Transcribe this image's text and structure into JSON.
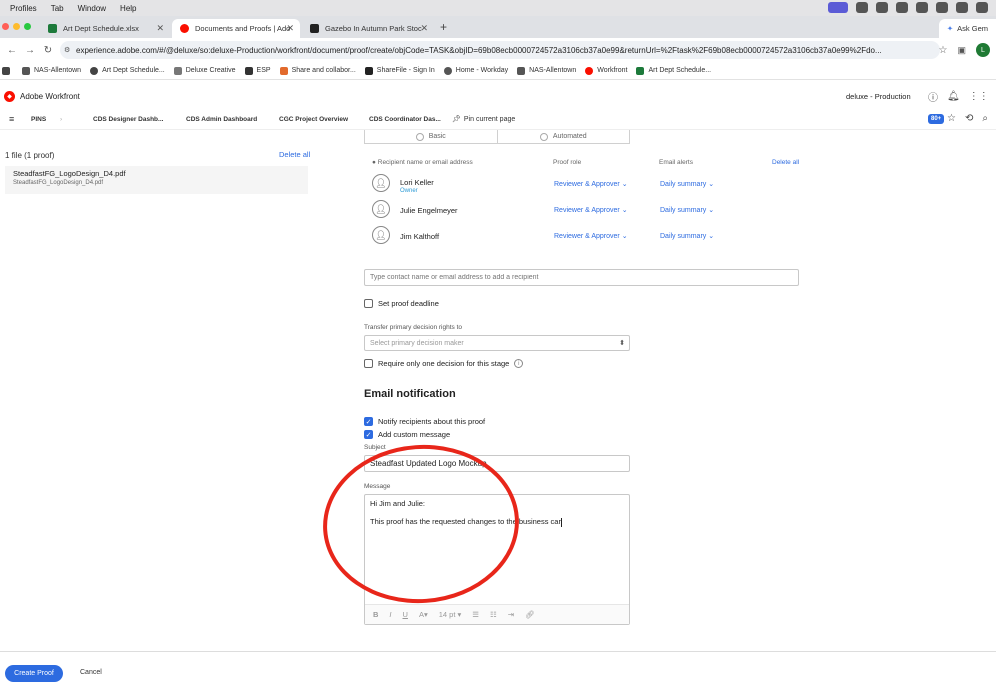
{
  "menubar": {
    "items": [
      "Profiles",
      "Tab",
      "Window",
      "Help"
    ]
  },
  "tabs": [
    {
      "title": "Art Dept Schedule.xlsx",
      "icon": "excel-icon",
      "color": "#1d7a3b"
    },
    {
      "title": "Documents and Proofs | Ado",
      "icon": "workfront-icon",
      "color": "#fa0f00"
    },
    {
      "title": "Gazebo In Autumn Park Stoc",
      "icon": "shutterstock-icon",
      "color": "#222222"
    }
  ],
  "ask_gemini": "Ask Gem",
  "address": {
    "url": "experience.adobe.com/#/@deluxe/so:deluxe-Production/workfront/document/proof/create/objCode=TASK&objID=69b08ecb0000724572a3106cb37a0e99&returnUrl=%2Ftask%2F69b08ecb0000724572a3106cb37a0e99%2Fdo...",
    "avatar_letter": "L"
  },
  "bookmarks": [
    {
      "label": "NAS-Allentown",
      "color": "#555555"
    },
    {
      "label": "Art Dept Schedule...",
      "color": "#444444"
    },
    {
      "label": "Deluxe Creative",
      "color": "#777777"
    },
    {
      "label": "ESP",
      "color": "#333333"
    },
    {
      "label": "Share and collabor...",
      "color": "#e26a2c"
    },
    {
      "label": "ShareFile - Sign In",
      "color": "#222222"
    },
    {
      "label": "Home - Workday",
      "color": "#555555"
    },
    {
      "label": "NAS-Allentown",
      "color": "#555555"
    },
    {
      "label": "Workfront",
      "color": "#fa0f00"
    },
    {
      "label": "Art Dept Schedule...",
      "color": "#1d7a3b"
    }
  ],
  "app": {
    "title": "Adobe Workfront",
    "environment": "deluxe - Production"
  },
  "pins": {
    "label": "PINS",
    "items": [
      "CDS Designer Dashb...",
      "CDS Admin Dashboard",
      "CGC Project Overview",
      "CDS Coordinator Das..."
    ],
    "pin_current": "Pin current page",
    "badge": "80+"
  },
  "files": {
    "header": "1 file (1 proof)",
    "delete_all": "Delete all",
    "file_name": "SteadfastFG_LogoDesign_D4.pdf",
    "file_sub": "SteadfastFG_LogoDesign_D4.pdf"
  },
  "workflow": {
    "basic": "Basic",
    "automated": "Automated"
  },
  "recipients": {
    "col_name": "Recipient name or email address",
    "col_role": "Proof role",
    "col_alerts": "Email alerts",
    "delete_all": "Delete all",
    "rows": [
      {
        "name": "Lori Keller",
        "tag": "Owner",
        "role": "Reviewer & Approver",
        "alert": "Daily summary"
      },
      {
        "name": "Julie Engelmeyer",
        "tag": "",
        "role": "Reviewer & Approver",
        "alert": "Daily summary"
      },
      {
        "name": "Jim Kalthoff",
        "tag": "",
        "role": "Reviewer & Approver",
        "alert": "Daily summary"
      }
    ],
    "add_placeholder": "Type contact name or email address to add a recipient"
  },
  "options": {
    "set_deadline": "Set proof deadline",
    "transfer_label": "Transfer primary decision rights to",
    "decision_placeholder": "Select primary decision maker",
    "require_one": "Require only one decision for this stage"
  },
  "email": {
    "title": "Email notification",
    "notify": "Notify recipients about this proof",
    "custom_msg": "Add custom message",
    "subject_label": "Subject",
    "subject_value": "Steadfast Updated Logo Mockup",
    "message_label": "Message",
    "message_line1": "Hi Jim and Julie:",
    "message_line2": "This proof has the requested changes to the business car",
    "font_size": "14 pt"
  },
  "footer": {
    "create": "Create Proof",
    "cancel": "Cancel"
  },
  "colors": {
    "accent": "#2d6be0",
    "annotation": "#e8261a"
  }
}
